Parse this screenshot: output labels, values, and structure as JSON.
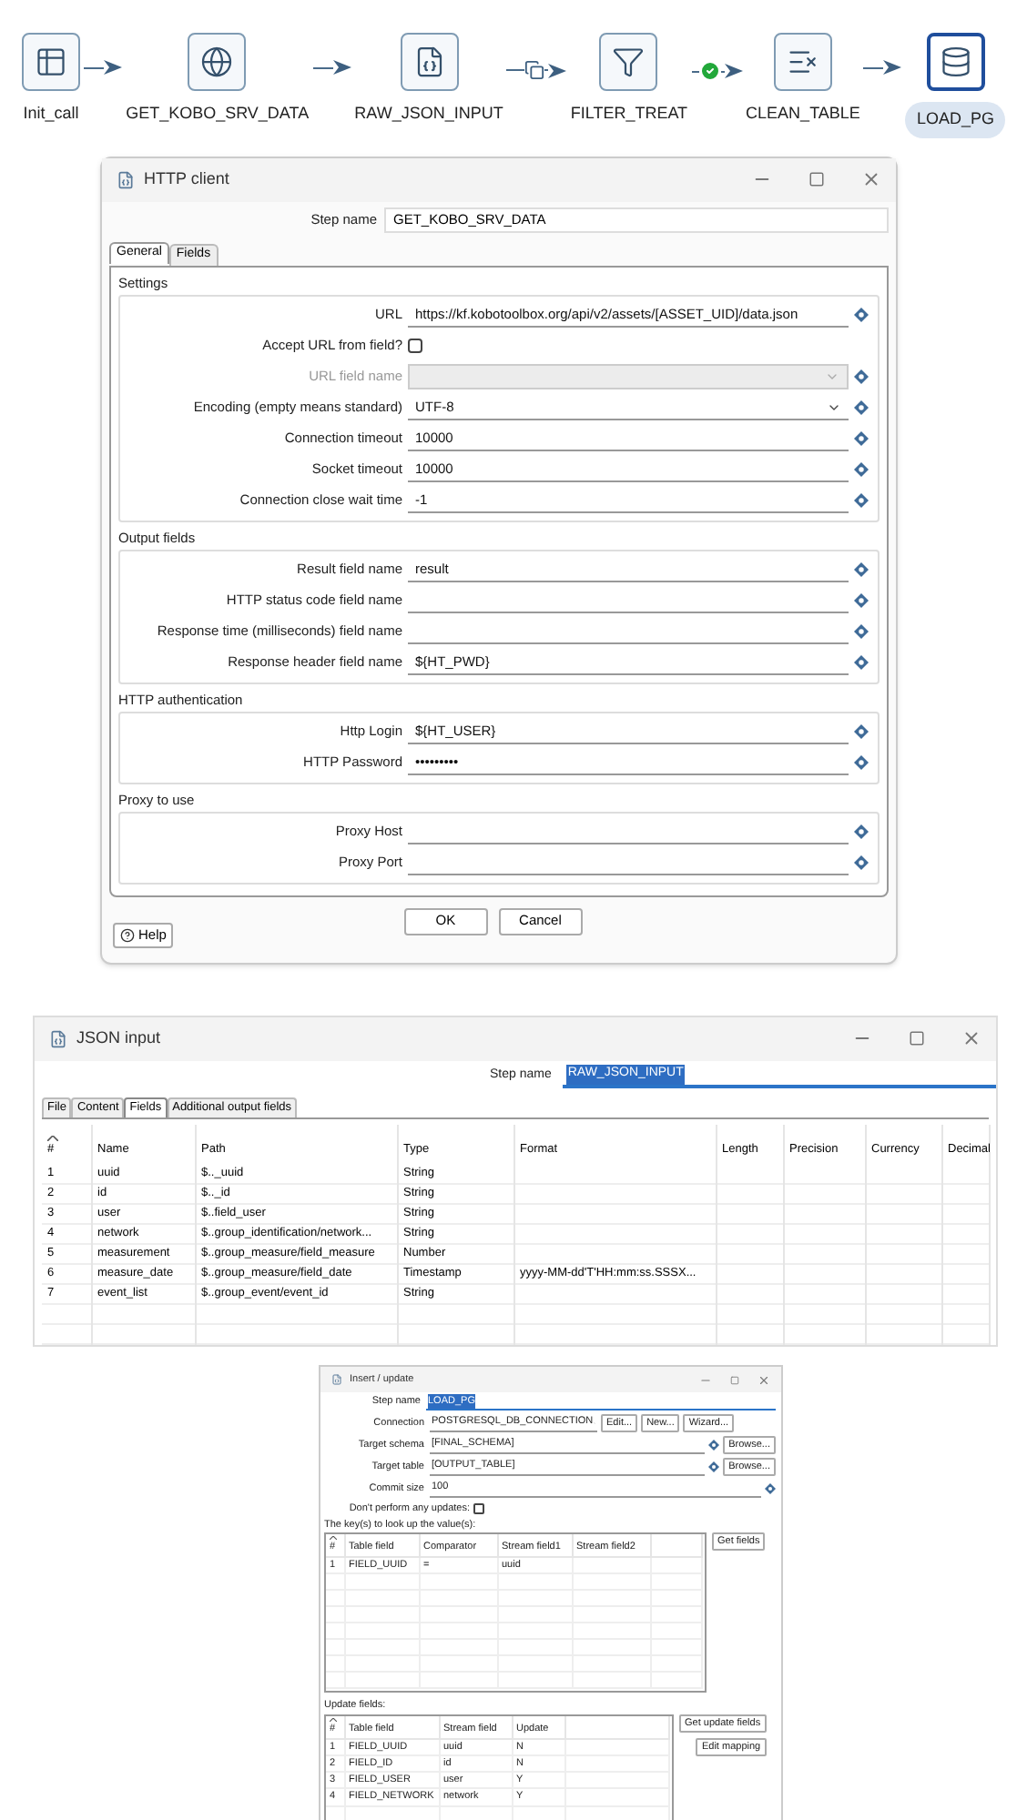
{
  "pipeline": {
    "steps": [
      {
        "label": "Init_call",
        "kind": "start",
        "selected": false
      },
      {
        "label": "GET_KOBO_SRV_DATA",
        "kind": "http",
        "selected": false
      },
      {
        "label": "RAW_JSON_INPUT",
        "kind": "json",
        "selected": false
      },
      {
        "label": "FILTER_TREAT",
        "kind": "filter",
        "selected": false
      },
      {
        "label": "CLEAN_TABLE",
        "kind": "clean",
        "selected": false
      },
      {
        "label": "LOAD_PG",
        "kind": "load",
        "selected": true
      }
    ],
    "hops": [
      {
        "kind": "plain"
      },
      {
        "kind": "plain"
      },
      {
        "kind": "copy"
      },
      {
        "kind": "ok"
      },
      {
        "kind": "plain"
      }
    ]
  },
  "http_dialog": {
    "title": "HTTP client",
    "step_name_label": "Step name",
    "step_name": "GET_KOBO_SRV_DATA",
    "tabs": [
      {
        "label": "General",
        "selected": true
      },
      {
        "label": "Fields",
        "selected": false
      }
    ],
    "sections": [
      {
        "title": "Settings",
        "rows": [
          {
            "label": "URL",
            "kind": "text",
            "value": "https://kf.kobotoolbox.org/api/v2/assets/[ASSET_UID]/data.json",
            "disabled": false
          },
          {
            "label": "Accept URL from field?",
            "kind": "checkbox",
            "checked": false,
            "disabled": false
          },
          {
            "label": "URL field name",
            "kind": "combo",
            "disabled": true
          },
          {
            "label": "Encoding (empty means standard)",
            "kind": "combo",
            "value": "UTF-8",
            "disabled": false
          },
          {
            "label": "Connection timeout",
            "kind": "text",
            "value": "10000",
            "disabled": false
          },
          {
            "label": "Socket timeout",
            "kind": "text",
            "value": "10000",
            "disabled": false
          },
          {
            "label": "Connection close wait time",
            "kind": "text",
            "value": "-1",
            "disabled": false
          }
        ]
      },
      {
        "title": "Output fields",
        "rows": [
          {
            "label": "Result field name",
            "kind": "text",
            "value": "result",
            "disabled": false
          },
          {
            "label": "HTTP status code field name",
            "kind": "text",
            "disabled": false
          },
          {
            "label": "Response time (milliseconds) field name",
            "kind": "text",
            "disabled": false
          },
          {
            "label": "Response header field name",
            "kind": "text",
            "value": "${HT_PWD}",
            "disabled": false
          }
        ]
      },
      {
        "title": "HTTP authentication",
        "rows": [
          {
            "label": "Http Login",
            "kind": "text",
            "value": "${HT_USER}",
            "disabled": false
          },
          {
            "label": "HTTP Password",
            "kind": "text",
            "value": "•••••••••",
            "disabled": false
          }
        ]
      },
      {
        "title": "Proxy to use",
        "rows": [
          {
            "label": "Proxy Host",
            "kind": "text",
            "disabled": false
          },
          {
            "label": "Proxy Port",
            "kind": "text",
            "disabled": false
          }
        ]
      }
    ],
    "buttons": [
      "OK",
      "Cancel"
    ],
    "help": "Help"
  },
  "json_dialog": {
    "title": "JSON input",
    "step_name_label": "Step name",
    "step_name": "RAW_JSON_INPUT",
    "step_name_highlighted": true,
    "tabs": [
      {
        "label": "File",
        "selected": false
      },
      {
        "label": "Content",
        "selected": false
      },
      {
        "label": "Fields",
        "selected": true
      },
      {
        "label": "Additional output fields",
        "selected": false
      }
    ],
    "columns": [
      "#",
      "Name",
      "Path",
      "Type",
      "Format",
      "Length",
      "Precision",
      "Currency",
      "Decimal"
    ],
    "rows": [
      [
        "1",
        "uuid",
        "$.._uuid",
        "String",
        ""
      ],
      [
        "2",
        "id",
        "$.._id",
        "String",
        ""
      ],
      [
        "3",
        "user",
        "$..field_user",
        "String",
        ""
      ],
      [
        "4",
        "network",
        "$..group_identification/network...",
        "String",
        ""
      ],
      [
        "5",
        "measurement",
        "$..group_measure/field_measure",
        "Number",
        ""
      ],
      [
        "6",
        "measure_date",
        "$..group_measure/field_date",
        "Timestamp",
        "yyyy-MM-dd'T'HH:mm:ss.SSSX..."
      ],
      [
        "7",
        "event_list",
        "$..group_event/event_id",
        "String",
        ""
      ]
    ]
  },
  "insert_dialog": {
    "title": "Insert / update",
    "step_name_label": "Step name",
    "step_name": "LOAD_PG",
    "step_name_highlighted": true,
    "fields": [
      {
        "label": "Connection",
        "kind": "combo",
        "value": "POSTGRESQL_DB_CONNECTION",
        "buttons": [
          "Edit...",
          "New...",
          "Wizard..."
        ]
      },
      {
        "label": "Target schema",
        "kind": "text",
        "value": "[FINAL_SCHEMA]",
        "buttons": [
          "Browse..."
        ]
      },
      {
        "label": "Target table",
        "kind": "text",
        "value": "[OUTPUT_TABLE]",
        "buttons": [
          "Browse..."
        ]
      },
      {
        "label": "Commit size",
        "kind": "text",
        "value": "100"
      }
    ],
    "no_updates": {
      "label": "Don't perform any updates:",
      "checked": false
    },
    "keys_label": "The key(s) to look up the value(s):",
    "keys_columns": [
      "#",
      "Table field",
      "Comparator",
      "Stream field1",
      "Stream field2"
    ],
    "keys_rows": [
      [
        "1",
        "FIELD_UUID",
        "=",
        "uuid",
        ""
      ]
    ],
    "keys_button": "Get fields",
    "update_label": "Update fields:",
    "update_columns": [
      "#",
      "Table field",
      "Stream field",
      "Update"
    ],
    "update_rows": [
      [
        "1",
        "FIELD_UUID",
        "uuid",
        "N"
      ],
      [
        "2",
        "FIELD_ID",
        "id",
        "N"
      ],
      [
        "3",
        "FIELD_USER",
        "user",
        "Y"
      ],
      [
        "4",
        "FIELD_NETWORK",
        "network",
        "Y"
      ]
    ],
    "update_buttons": [
      "Get update fields",
      "Edit mapping"
    ]
  }
}
